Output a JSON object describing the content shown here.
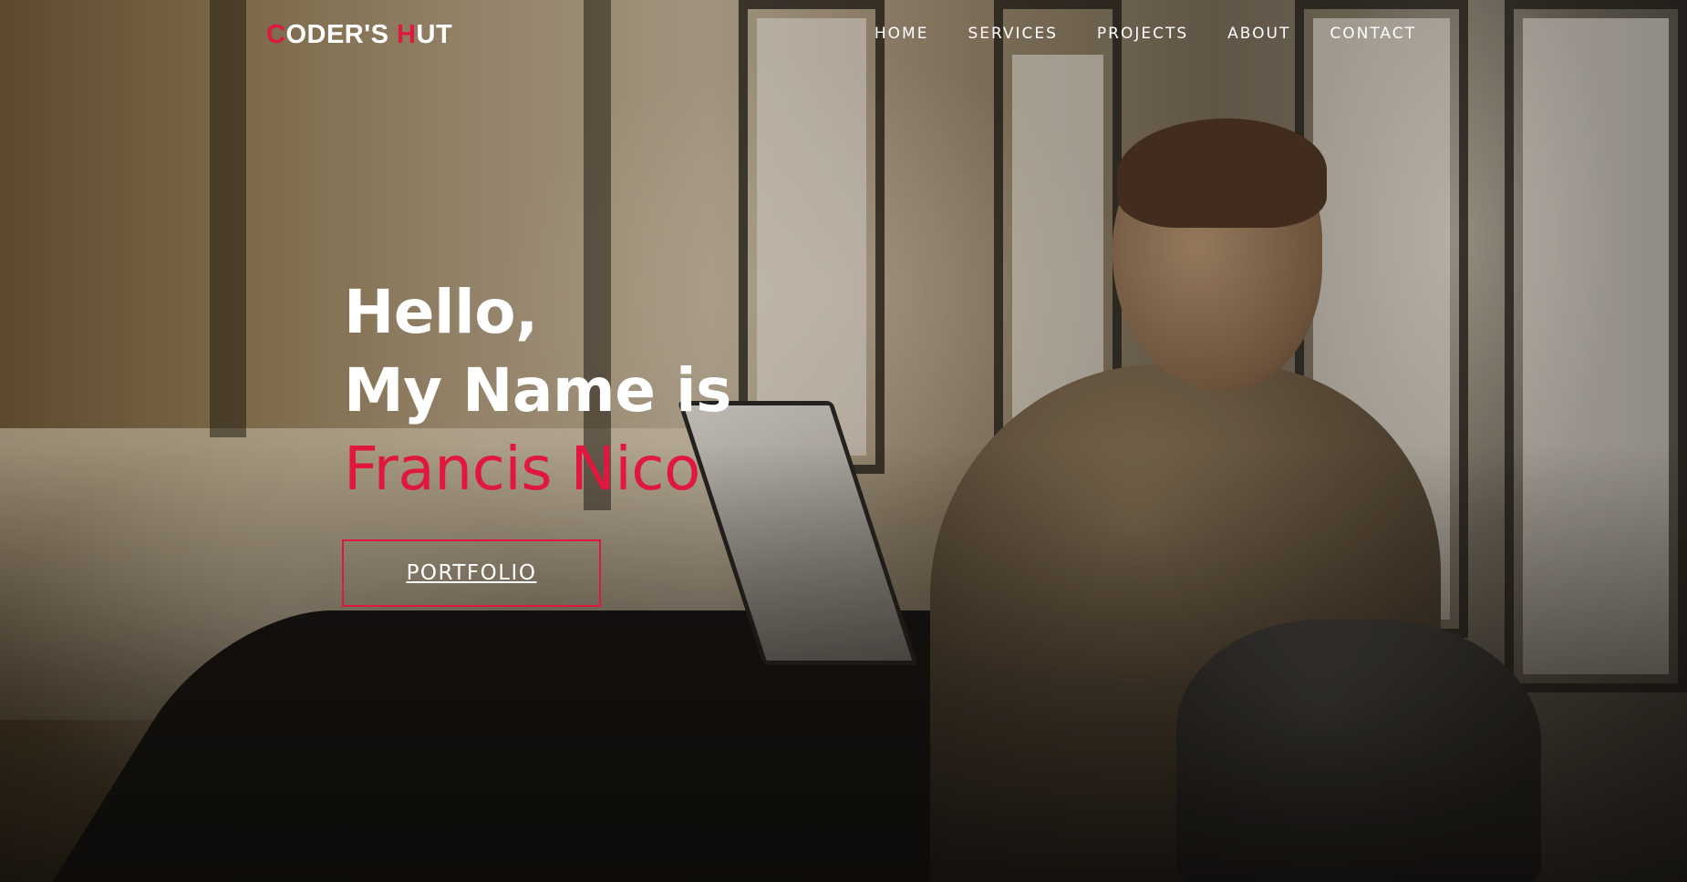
{
  "brand": {
    "logo_parts": [
      {
        "text": "C",
        "accent": true
      },
      {
        "text": "ODER'S ",
        "accent": false
      },
      {
        "text": "H",
        "accent": true
      },
      {
        "text": "UT",
        "accent": false
      }
    ]
  },
  "nav": {
    "items": [
      {
        "label": "HOME"
      },
      {
        "label": "SERVICES"
      },
      {
        "label": "PROJECTS"
      },
      {
        "label": "ABOUT"
      },
      {
        "label": "CONTACT"
      }
    ]
  },
  "hero": {
    "greeting": "Hello,",
    "intro": "My Name is",
    "name": "Francis Nico",
    "cta_label": "PORTFOLIO"
  },
  "colors": {
    "accent": "#e0183f",
    "text": "#ffffff"
  }
}
